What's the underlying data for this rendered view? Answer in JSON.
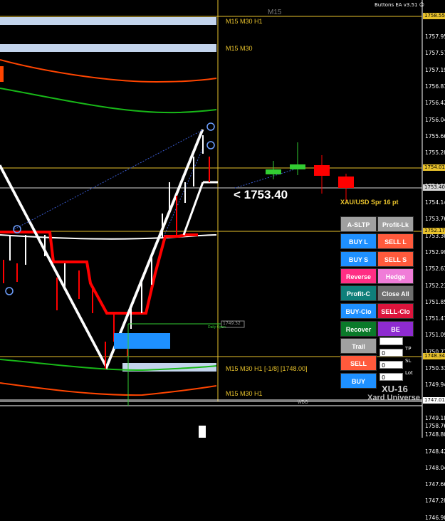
{
  "header": {
    "ea_label": "Buttons EA  v3.51",
    "smiley_icon": "smiley-icon",
    "timeframe_watermark": "M15"
  },
  "price_axis": {
    "ticks": [
      "1757.95",
      "1757.57",
      "1757.19",
      "1756.81",
      "1756.42",
      "1756.04",
      "1755.66",
      "1755.28",
      "1754.90",
      "1754.52",
      "1754.14",
      "1753.76",
      "1753.38",
      "1752.99",
      "1752.61",
      "1752.23",
      "1751.85",
      "1751.47",
      "1751.09",
      "1750.71",
      "1750.33",
      "1749.94",
      "1749.56",
      "1749.18",
      "1748.80",
      "1748.42",
      "1748.04",
      "1747.66",
      "1747.28",
      "1746.90"
    ],
    "bottom_label": "1758.7627",
    "boxes": [
      {
        "label": "1758.55",
        "color": "#e8c22c"
      },
      {
        "label": "1754.01",
        "color": "#e8c22c"
      },
      {
        "label": "1753.40",
        "color": "#d8d8d8"
      },
      {
        "label": "1752.17",
        "color": "#e8c22c"
      },
      {
        "label": "1748.34",
        "color": "#e8c22c"
      },
      {
        "label": "1747.01",
        "color": "#ffffff"
      }
    ]
  },
  "chart": {
    "zones": {
      "top1": "M15 M30 H1",
      "top2": "M15 M30",
      "bottom1": "M15 M30 H1 [-1/8] [1748.00]",
      "bottom2": "M15 M30 H1"
    },
    "price_display": "<  1753.40",
    "spread_text": "XAU/USD Spr 16 pt",
    "daily_open_label": "Daily Open",
    "daily_open_price": "1749.32",
    "bottom_marker": "WDO"
  },
  "panel": {
    "buttons": [
      {
        "id": "a-sltp",
        "label": "A-SLTP",
        "bg": "#a0a0a0",
        "fg": "#ffffff"
      },
      {
        "id": "profit-lk",
        "label": "Profit-Lk",
        "bg": "#a0a0a0",
        "fg": "#ffffff"
      },
      {
        "id": "buy-l",
        "label": "BUY L",
        "bg": "#1e90ff",
        "fg": "#ffffff"
      },
      {
        "id": "sell-l",
        "label": "SELL L",
        "bg": "#ff5a3c",
        "fg": "#ffffff"
      },
      {
        "id": "buy-s",
        "label": "BUY S",
        "bg": "#1e90ff",
        "fg": "#ffffff"
      },
      {
        "id": "sell-s",
        "label": "SELL S",
        "bg": "#ff5a3c",
        "fg": "#ffffff"
      },
      {
        "id": "reverse",
        "label": "Reverse",
        "bg": "#ff2e84",
        "fg": "#ffffff"
      },
      {
        "id": "hedge",
        "label": "Hedge",
        "bg": "#f07cd8",
        "fg": "#ffffff"
      },
      {
        "id": "profit-c",
        "label": "Profit-C",
        "bg": "#0f7f7a",
        "fg": "#ffffff"
      },
      {
        "id": "close-all",
        "label": "Close All",
        "bg": "#6e6e6e",
        "fg": "#ffffff"
      },
      {
        "id": "buy-clo",
        "label": "BUY-Clo",
        "bg": "#1e90ff",
        "fg": "#ffffff"
      },
      {
        "id": "sell-clo",
        "label": "SELL-Clo",
        "bg": "#dc143c",
        "fg": "#ffffff"
      },
      {
        "id": "recover",
        "label": "Recover",
        "bg": "#0a7a2a",
        "fg": "#ffffff"
      },
      {
        "id": "be",
        "label": "BE",
        "bg": "#8e2bd0",
        "fg": "#ffffff"
      },
      {
        "id": "trail",
        "label": "Trail",
        "bg": "#a0a0a0",
        "fg": "#ffffff"
      },
      {
        "id": "sell",
        "label": "SELL",
        "bg": "#ff5a3c",
        "fg": "#ffffff"
      },
      {
        "id": "buy",
        "label": "BUY",
        "bg": "#1e90ff",
        "fg": "#ffffff"
      }
    ],
    "fields": [
      {
        "id": "field-1",
        "value": "",
        "label": ""
      },
      {
        "id": "tp",
        "value": "0",
        "label": "TP"
      },
      {
        "id": "sl",
        "value": "0",
        "label": "SL"
      },
      {
        "id": "lot",
        "value": "0",
        "label": "Lot"
      }
    ],
    "brand_line1": "XU-16",
    "brand_line2": "Xard Universe"
  },
  "colors": {
    "zone_bar": "#c3d4ec",
    "guide_line": "#e8c22c",
    "bull": "#32cd32",
    "bear": "#ff0000"
  }
}
